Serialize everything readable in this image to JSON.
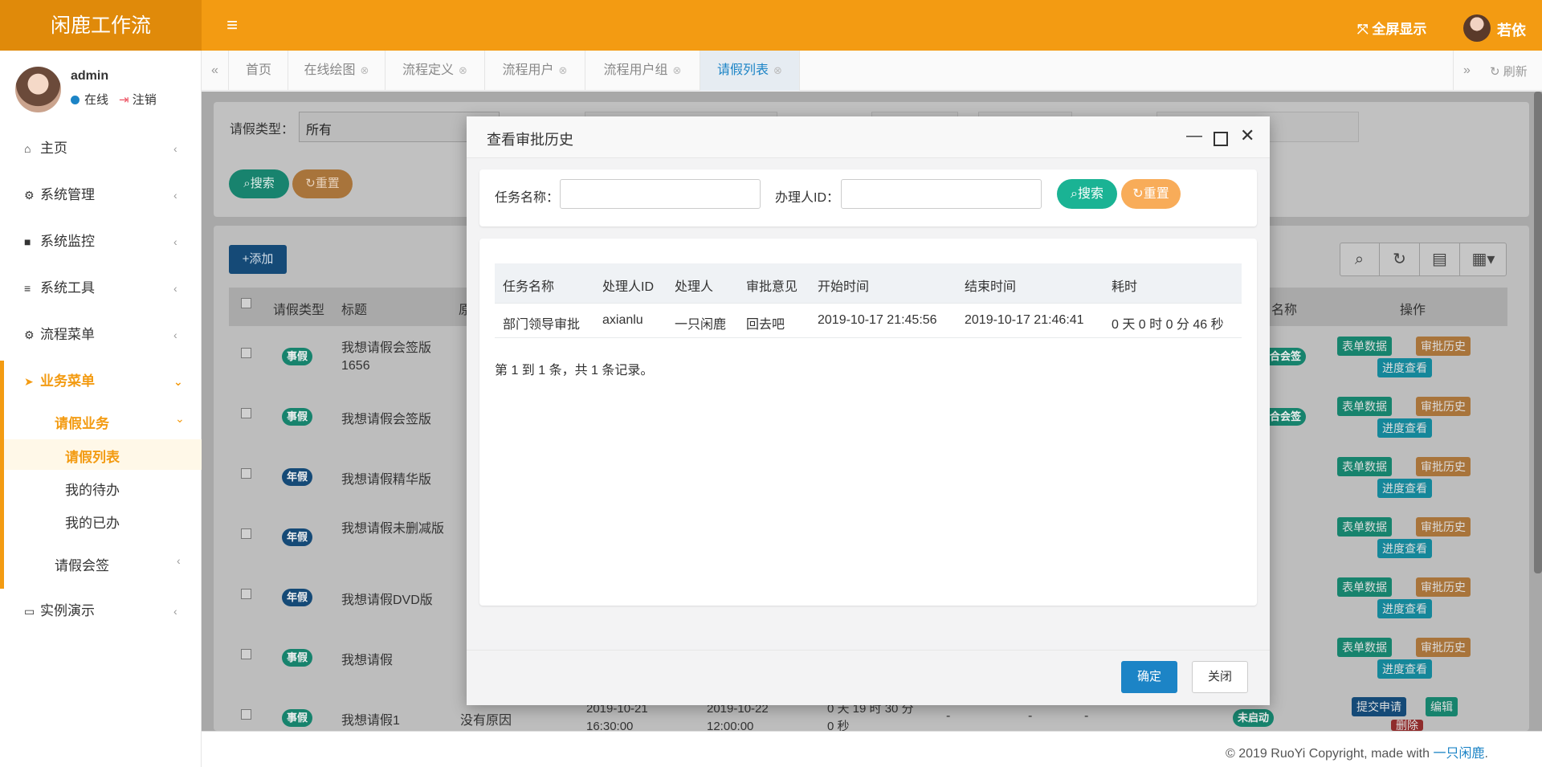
{
  "header": {
    "brand": "闲鹿工作流",
    "menu_icon": "bars-icon",
    "fullscreen": "全屏显示",
    "username": "若依"
  },
  "sidebar": {
    "user": {
      "name": "admin",
      "status": "在线",
      "logout": "注销"
    },
    "items": [
      {
        "label": "主页",
        "icon": "home-icon"
      },
      {
        "label": "系统管理",
        "icon": "gear-icon"
      },
      {
        "label": "系统监控",
        "icon": "video-icon"
      },
      {
        "label": "系统工具",
        "icon": "bars-icon"
      },
      {
        "label": "流程菜单",
        "icon": "cogs-icon"
      },
      {
        "label": "业务菜单",
        "icon": "paper-plane-icon"
      },
      {
        "label": "实例演示",
        "icon": "desktop-icon"
      }
    ],
    "sub": {
      "group": "请假业务",
      "children": [
        "请假列表",
        "我的待办",
        "我的已办"
      ],
      "group2": "请假会签"
    }
  },
  "tabs": [
    "首页",
    "在线绘图",
    "流程定义",
    "流程用户",
    "流程用户组",
    "请假列表"
  ],
  "refresh": "刷新",
  "background_page": {
    "search_label": "请假类型：",
    "search_select": "所有",
    "search_button": "搜索",
    "reset_button": "重置",
    "add_button": "添加",
    "columns": [
      "请假类型",
      "标题",
      "原",
      "名称",
      "操作"
    ],
    "rows": [
      {
        "type": "事假",
        "title": "我想请假会签版 1656",
        "status": "会合会签",
        "ops": [
          "表单数据",
          "审批历史",
          "进度查看"
        ]
      },
      {
        "type": "事假",
        "title": "我想请假会签版",
        "status": "会合会签",
        "ops": [
          "表单数据",
          "审批历史",
          "进度查看"
        ]
      },
      {
        "type": "年假",
        "title": "我想请假精华版",
        "ops": [
          "表单数据",
          "审批历史",
          "进度查看"
        ]
      },
      {
        "type": "年假",
        "title": "我想请假未删减版",
        "ops": [
          "表单数据",
          "审批历史",
          "进度查看"
        ]
      },
      {
        "type": "年假",
        "title": "我想请假DVD版",
        "ops": [
          "表单数据",
          "审批历史",
          "进度查看"
        ]
      },
      {
        "type": "事假",
        "title": "我想请假",
        "ops": [
          "表单数据",
          "审批历史",
          "进度查看"
        ]
      },
      {
        "type": "事假",
        "title": "我想请假1",
        "reason": "没有原因",
        "start": "2019-10-21 16:30:00",
        "end": "2019-10-22 12:00:00",
        "duration": "0 天 19 时 30 分 0 秒",
        "dash": "-",
        "status": "未启动",
        "ops": [
          "提交申请",
          "编辑",
          "删除"
        ]
      }
    ]
  },
  "modal": {
    "title": "查看审批历史",
    "search": {
      "task_label": "任务名称：",
      "assignee_label": "办理人ID：",
      "search_button": "搜索",
      "reset_button": "重置"
    },
    "columns": [
      "任务名称",
      "处理人ID",
      "处理人",
      "审批意见",
      "开始时间",
      "结束时间",
      "耗时"
    ],
    "rows": [
      [
        "部门领导审批",
        "axianlu",
        "一只闲鹿",
        "回去吧",
        "2019-10-17 21:45:56",
        "2019-10-17 21:46:41",
        "0 天 0 时 0 分 46 秒"
      ]
    ],
    "summary": "第 1 到 1 条，共 1 条记录。",
    "ok_button": "确定",
    "close_button": "关闭"
  },
  "footer": {
    "text": "© 2019 RuoYi Copyright, made with ",
    "link": "一只闲鹿",
    "suffix": "."
  },
  "colors": {
    "brand_orange": "#f39b12",
    "primary_blue": "#1c84c6",
    "teal": "#1ab394",
    "warning_orange": "#f8ac59"
  }
}
